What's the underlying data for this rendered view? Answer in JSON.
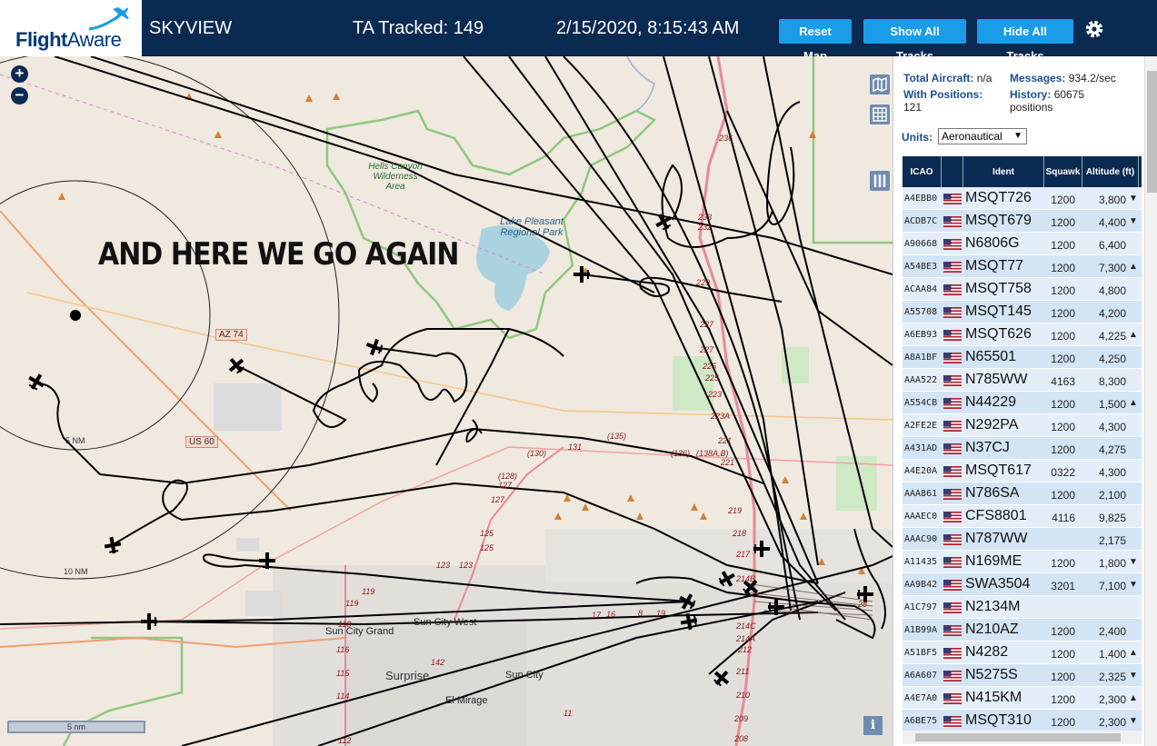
{
  "header": {
    "logo_bold": "Flight",
    "logo_rest": "Aware",
    "app_title": "SKYVIEW",
    "tracked": "TA Tracked: 149",
    "datetime": "2/15/2020, 8:15:43 AM",
    "buttons": {
      "reset": "Reset Map",
      "show_all": "Show All Tracks",
      "hide_all": "Hide All Tracks"
    }
  },
  "map": {
    "zoom_in": "+",
    "zoom_out": "−",
    "overlay_text": "AND HERE WE GO AGAIN",
    "scale_label": "5 nm",
    "info": "i",
    "range_rings": [
      "5 NM",
      "10 NM"
    ],
    "labels": {
      "hells_canyon": "Hells Canyon Wilderness Area",
      "lake_pleasant": "Lake Pleasant Regional Park",
      "az74": "AZ 74",
      "us60": "US 60",
      "sun_city_grand": "Sun City Grand",
      "sun_city_west": "Sun City West",
      "surprise": "Surprise",
      "sun_city": "Sun City",
      "el_mirage": "El Mirage"
    },
    "road_numbers": [
      "236",
      "233",
      "232",
      "229",
      "227",
      "227",
      "225",
      "225",
      "223",
      "223A",
      "221",
      "221",
      "219",
      "218",
      "217",
      "214B",
      "214C",
      "214A",
      "212",
      "211",
      "210",
      "209",
      "208",
      "(130)",
      "131",
      "(135)",
      "(136)",
      "(138A,B)",
      "(128)",
      "127",
      "127",
      "125",
      "125",
      "123",
      "123",
      "119",
      "119",
      "118",
      "116",
      "115",
      "114",
      "142",
      "17",
      "16",
      "8",
      "19",
      "28",
      "11",
      "112"
    ]
  },
  "panel": {
    "total_aircraft_label": "Total Aircraft:",
    "total_aircraft_value": "n/a",
    "messages_label": "Messages:",
    "messages_value": "934.2/sec",
    "with_positions_label": "With Positions:",
    "with_positions_value": "121",
    "history_label": "History:",
    "history_value": "60675 positions",
    "units_label": "Units:",
    "units_value": "Aeronautical",
    "columns": [
      "ICAO",
      "",
      "Ident",
      "Squawk",
      "Altitude (ft)"
    ],
    "rows": [
      {
        "icao": "A4EBB0",
        "ident": "MSQT726",
        "squawk": "1200",
        "alt": "3,800",
        "trend": "▼"
      },
      {
        "icao": "ACDB7C",
        "ident": "MSQT679",
        "squawk": "1200",
        "alt": "4,400",
        "trend": "▼"
      },
      {
        "icao": "A90668",
        "ident": "N6806G",
        "squawk": "1200",
        "alt": "6,400",
        "trend": ""
      },
      {
        "icao": "A54BE3",
        "ident": "MSQT77",
        "squawk": "1200",
        "alt": "7,300",
        "trend": "▲"
      },
      {
        "icao": "ACAA84",
        "ident": "MSQT758",
        "squawk": "1200",
        "alt": "4,800",
        "trend": ""
      },
      {
        "icao": "A55708",
        "ident": "MSQT145",
        "squawk": "1200",
        "alt": "4,200",
        "trend": ""
      },
      {
        "icao": "A6EB93",
        "ident": "MSQT626",
        "squawk": "1200",
        "alt": "4,225",
        "trend": "▲"
      },
      {
        "icao": "A8A1BF",
        "ident": "N65501",
        "squawk": "1200",
        "alt": "4,250",
        "trend": ""
      },
      {
        "icao": "AAA522",
        "ident": "N785WW",
        "squawk": "4163",
        "alt": "8,300",
        "trend": ""
      },
      {
        "icao": "A554CB",
        "ident": "N44229",
        "squawk": "1200",
        "alt": "1,500",
        "trend": "▲"
      },
      {
        "icao": "A2FE2E",
        "ident": "N292PA",
        "squawk": "1200",
        "alt": "4,300",
        "trend": ""
      },
      {
        "icao": "A431AD",
        "ident": "N37CJ",
        "squawk": "1200",
        "alt": "4,275",
        "trend": ""
      },
      {
        "icao": "A4E20A",
        "ident": "MSQT617",
        "squawk": "0322",
        "alt": "4,300",
        "trend": ""
      },
      {
        "icao": "AAA861",
        "ident": "N786SA",
        "squawk": "1200",
        "alt": "2,100",
        "trend": ""
      },
      {
        "icao": "AAAEC0",
        "ident": "CFS8801",
        "squawk": "4116",
        "alt": "9,825",
        "trend": ""
      },
      {
        "icao": "AAAC90",
        "ident": "N787WW",
        "squawk": "",
        "alt": "2,175",
        "trend": ""
      },
      {
        "icao": "A11435",
        "ident": "N169ME",
        "squawk": "1200",
        "alt": "1,800",
        "trend": "▼"
      },
      {
        "icao": "AA9B42",
        "ident": "SWA3504",
        "squawk": "3201",
        "alt": "7,100",
        "trend": "▼"
      },
      {
        "icao": "A1C797",
        "ident": "N2134M",
        "squawk": "",
        "alt": "",
        "trend": ""
      },
      {
        "icao": "A1B99A",
        "ident": "N210AZ",
        "squawk": "1200",
        "alt": "2,400",
        "trend": ""
      },
      {
        "icao": "A51BF5",
        "ident": "N4282",
        "squawk": "1200",
        "alt": "1,400",
        "trend": "▲"
      },
      {
        "icao": "A6A607",
        "ident": "N5275S",
        "squawk": "1200",
        "alt": "2,325",
        "trend": "▼"
      },
      {
        "icao": "A4E7A0",
        "ident": "N415KM",
        "squawk": "1200",
        "alt": "2,300",
        "trend": "▲"
      },
      {
        "icao": "A6BE75",
        "ident": "MSQT310",
        "squawk": "1200",
        "alt": "2,300",
        "trend": "▼"
      }
    ]
  },
  "colors": {
    "header_bg": "#0a2a52",
    "button": "#1a9ce8",
    "row_odd": "#e4eef8",
    "row_even": "#d3e4f4",
    "map_bg": "#efe9e0"
  },
  "icons": [
    "airplane-logo-icon",
    "gear-icon",
    "map-layers-icon",
    "grid-icon",
    "columns-icon",
    "us-flag-icon",
    "info-icon",
    "aircraft-icon"
  ]
}
